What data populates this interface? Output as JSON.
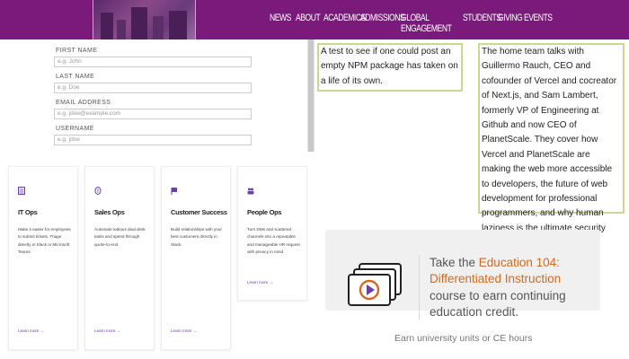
{
  "header": {
    "nav": [
      "NEWS",
      "ABOUT",
      "ACADEMICS",
      "ADMISSIONS",
      "GLOBAL ENGAGEMENT",
      "STUDENTS",
      "GIVING",
      "EVENTS"
    ],
    "bg_color": "#7a1a7a"
  },
  "form": {
    "first_name": {
      "label": "FIRST NAME",
      "placeholder": "e.g. John"
    },
    "last_name": {
      "label": "LAST NAME",
      "placeholder": "e.g. Doe"
    },
    "email": {
      "label": "EMAIL ADDRESS",
      "placeholder": "e.g. jdoe@example.com"
    },
    "username": {
      "label": "USERNAME",
      "placeholder": "e.g. jdoe"
    }
  },
  "cards": [
    {
      "title": "IT Ops",
      "icon": "server-icon",
      "desc": "Make it easier for employees to submit tickets. Triage directly in Slack or Microsoft Teams.",
      "link": "Learn more →"
    },
    {
      "title": "Sales Ops",
      "icon": "coin-icon",
      "desc": "Automate tedious deal desk tasks and speed through quote-to-end.",
      "link": "Learn more →"
    },
    {
      "title": "Customer Success",
      "icon": "flag-icon",
      "desc": "Build relationships with your best customers directly in Slack.",
      "link": "Learn more →"
    },
    {
      "title": "People Ops",
      "icon": "people-icon",
      "desc": "Turn DMs and scattered channels into a repeatable and manageable HR request with privacy in mind.",
      "link": "Learn more →"
    }
  ],
  "textbox1": "A test to see if one could post an empty NPM package has taken on a life of its own.",
  "textbox2": "The home team talks with Guillermo Rauch, CEO and cofounder of Vercel and cocreator of Next.js, and Sam Lambert, formerly VP of Engineering at Github and now CEO of PlanetScale. They cover how Vercel and PlanetScale are making the web more accessible to developers, the future of web development for professional programmers, and why human laziness is the ultimate security threat.",
  "promo": {
    "pre": "Take the ",
    "highlight": "Education 104: Differentiated Instruction",
    "post": " course to earn continuing education credit.",
    "sub": "Earn university units or CE hours",
    "icon": "video-cards-icon",
    "accent": "#d2691e"
  }
}
